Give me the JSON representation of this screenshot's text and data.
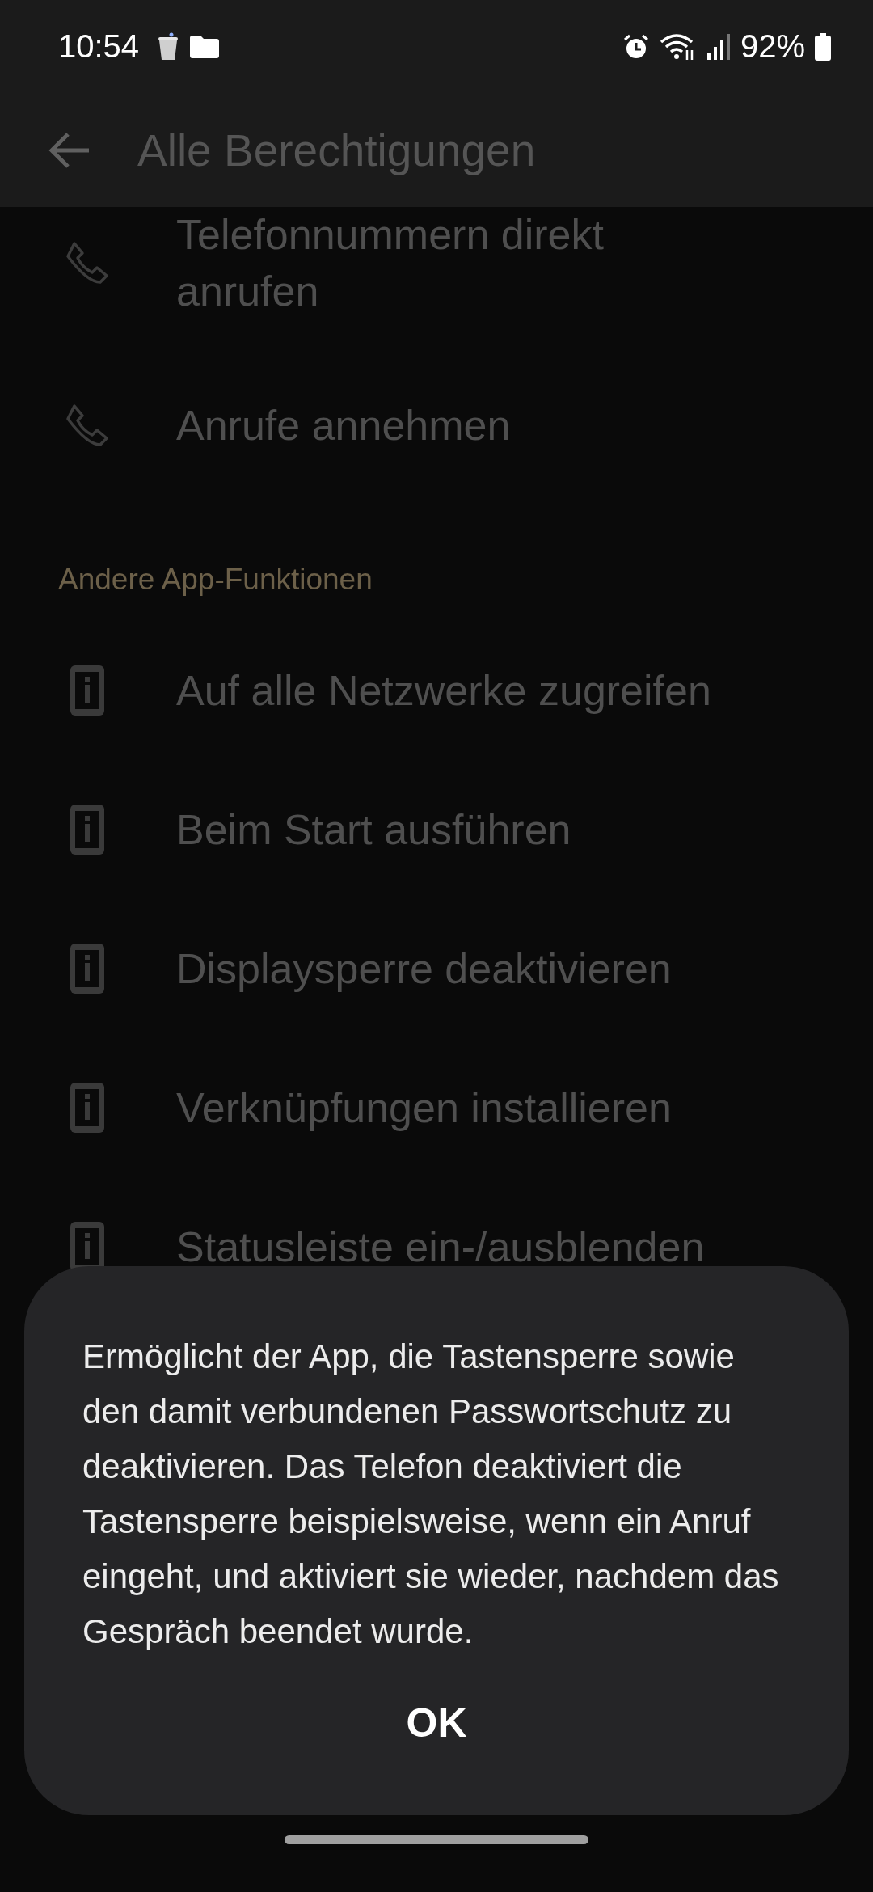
{
  "status_bar": {
    "time": "10:54",
    "battery": "92%"
  },
  "app_bar": {
    "title": "Alle Berechtigungen"
  },
  "sections": [
    {
      "items": [
        {
          "label": "Telefonnummern direkt anrufen",
          "kind": "phone"
        },
        {
          "label": "Anrufe annehmen",
          "kind": "phone"
        }
      ]
    },
    {
      "header": "Andere App-Funktionen",
      "items": [
        {
          "label": "Auf alle Netzwerke zugreifen",
          "kind": "info"
        },
        {
          "label": "Beim Start ausführen",
          "kind": "info"
        },
        {
          "label": "Displaysperre deaktivieren",
          "kind": "info"
        },
        {
          "label": "Verknüpfungen installieren",
          "kind": "info"
        },
        {
          "label": "Statusleiste ein-/ausblenden",
          "kind": "info"
        }
      ]
    }
  ],
  "dialog": {
    "message": "Ermöglicht der App, die Tastensperre sowie den damit verbundenen Passwortschutz zu deaktivieren. Das Telefon deaktiviert die Tastensperre beispielsweise, wenn ein Anruf eingeht, und aktiviert sie wieder, nachdem das Gespräch beendet wurde.",
    "button": "OK"
  }
}
